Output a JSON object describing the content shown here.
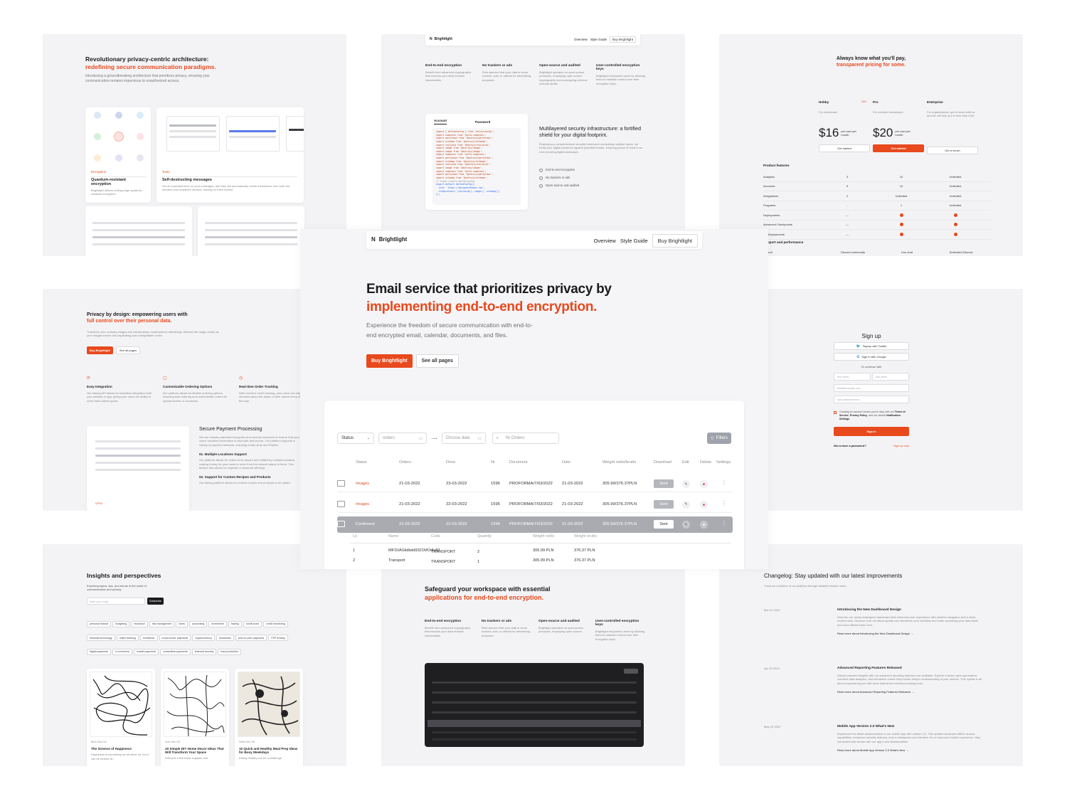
{
  "brand": {
    "name": "Brightlight"
  },
  "nav": {
    "overview": "Overview",
    "style_guide": "Style Guide",
    "buy": "Buy Brightlight"
  },
  "panel_arch": {
    "title1": "Revolutionary privacy-centric architecture:",
    "title2": "redefining secure communication paradigms.",
    "desc": "Introducing a groundbreaking architecture that prioritizes privacy, ensuring your communication remains impervious to unauthorized access.",
    "card1": {
      "tag": "Encryption",
      "title": "Quantum-resistant encryption",
      "desc": "Brightlight utilizes cutting-edge quantum-resistant encryption."
    },
    "card2": {
      "tag": "Tools",
      "title": "Self-destructing messages",
      "desc": "Set an expiration time on your messages, and they will automatically delete themselves from both the senders and recipient's devices, leaving no trace behind."
    }
  },
  "panel_features_top": {
    "features": [
      {
        "title": "End-to-end encryption",
        "desc": "Benefit from advanced cryptography that ensures your data remains inaccessible."
      },
      {
        "title": "No trackers or ads",
        "desc": "Rest assured that your data is never tracked, sold, or utilized for advertising purposes."
      },
      {
        "title": "Open-source and audited",
        "desc": "Brightlight operates on open-source principles, employing open source cryptography and undergoing external security audits."
      },
      {
        "title": "User-controlled encryption keys",
        "desc": "Brightlight empowers users by allowing them to maintain control over their encryption keys."
      }
    ],
    "tabs": [
      "Account",
      "Password"
    ],
    "code": [
      "import { defineConfig } from 'astro/config';",
      "import compress from 'astro-compress';",
      "import partytown from '@astrojs/partytown';",
      "import sitemap from '@astrojs/sitemap';",
      "import tailwind from '@astrojs/tailwind';",
      "import image from '@astrojs/image';",
      "import image from '@astrojs/image';",
      "import compress from 'astro-compress';",
      "import partytown from '@astrojs/partytown';",
      "import sitemap from '@astrojs/sitemap';",
      "import tailwind from '@astrojs/tailwind';",
      "import image from '@astrojs/image';",
      "import compress from 'astro-compress';",
      "import partytown from '@astrojs/partytown';",
      "import sitemap from '@astrojs/sitemap';",
      "// https://astro.build/config",
      "export default defineConfig({",
      "  site: 'https://designerthemes.com',",
      "  integrations: [tailwind(), image(), sitemap()]",
      "});"
    ],
    "security_title": "Multilayered security infrastructure: a fortified shield for your digital footprint.",
    "security_desc": "Employing a comprehensive security framework comprising multiple layers, we fortify your digital presence against potential threats, ensuring peace of mind in an ever-evolving digital landscape.",
    "checks": [
      "End-to-end encryption",
      "No trackers or ads",
      "Open-source and audited"
    ]
  },
  "panel_pricing": {
    "title1": "Always know what you'll pay,",
    "title2": "transparent pricing for some.",
    "plans": [
      {
        "name": "Hobby",
        "badge": "",
        "desc": "For individuals",
        "price": "$16",
        "unit": "per user per month",
        "cta": "Get started"
      },
      {
        "name": "Pro",
        "badge": "40%",
        "desc": "For medium businesses",
        "price": "$20",
        "unit": "per user per month",
        "cta": "Get started"
      },
      {
        "name": "Enterprise",
        "badge": "",
        "desc": "For organizations, get in touch with us and we will help you in less than 24hr.",
        "price": "",
        "unit": "",
        "cta": "Get in touch"
      }
    ],
    "section": "Product features",
    "rows": [
      {
        "label": "Analytics",
        "v": [
          "3",
          "10",
          "Unlimited"
        ]
      },
      {
        "label": "Accounts",
        "v": [
          "5",
          "10",
          "Unlimited"
        ]
      },
      {
        "label": "Integrations",
        "v": [
          "2",
          "Unlimited",
          "Unlimited"
        ]
      },
      {
        "label": "Programs",
        "v": [
          "-",
          "1",
          "Unlimited"
        ]
      },
      {
        "label": "Deployments",
        "v": [
          "—",
          "dot",
          "dot"
        ]
      },
      {
        "label": "Advanced Checkpoints",
        "v": [
          "—",
          "dot",
          "dot"
        ]
      },
      {
        "label": "ate Deployments",
        "v": [
          "—",
          "dot",
          "dot"
        ]
      }
    ],
    "section2": "pport and performance",
    "row_last": {
      "label": "port",
      "v": [
        "Discord community",
        "Live chat",
        "Dedicated Discord"
      ]
    }
  },
  "panel_privacy": {
    "title1": "Privacy by design: empowering users with",
    "title2": "full control over their personal data.",
    "desc": "Transform your ordinary images into extraordinary masterpieces effortlessly. Witness the magic unfold as your images evolve into captivating and unforgettable works",
    "buy": "Buy Brightlight",
    "see": "See all pages",
    "features": [
      {
        "title": "Easy Integration",
        "desc": "Our baking API allows for seamless integration with your website or app, giving your users the ability to order fresh baked goods."
      },
      {
        "title": "Customizable Ordering Options",
        "desc": "Our platform allows for flexible ordering options, including bulk ordering and customizable orders for special events or occasions."
      },
      {
        "title": "Real-time Order Tracking",
        "desc": "With real-time order tracking, your users can stay informed about the status of their orders every step of the way."
      }
    ],
    "payment_title": "Secure Payment Processing",
    "payment_desc": "We use industry-standard encryption and security measures to ensure that your users' sensitive information is kept safe and secure. Our platform supports a variety of payment methods, including credit cards and PayPal.",
    "sub1": "01. Multiple Locations Support",
    "sub1_desc": "Our platform allows for orders to be placed and fulfilled by multiple locations, making it easy for your users to order from the closest bakery to them. This feature also allows for regional or seasonal offerings.",
    "sub2": "02. Support for Custom Recipes and Products",
    "sub2_desc": "Our baking platform allows for custom recipes and products to be added",
    "tag": "GPNI"
  },
  "hero": {
    "title1": "Email service that prioritizes privacy by",
    "title2": "implementing end-to-end encryption.",
    "desc": "Experience the freedom of secure communication with end-to-end encrypted email, calendar, documents, and files.",
    "buy": "Buy Brightlight",
    "see": "See all pages"
  },
  "table": {
    "filter_status": "Status",
    "filter_orders": "orders",
    "filter_date": "Choose date",
    "search_placeholder": "Nr Orders",
    "filters_btn": "Filters",
    "headers": [
      "Status",
      "Orders",
      "Done",
      "Nr",
      "Document",
      "Date",
      "Weight netto/brutto",
      "Download",
      "Edit",
      "Delete",
      "Settings"
    ],
    "rows": [
      {
        "status": "Images",
        "orders": "21-03-2022",
        "done": "23-03-2022",
        "nr": "1596",
        "doc": "PROFORMA/7/03/2022",
        "date": "21-03-2022",
        "weight": "305.99/376.37PLN",
        "btn": "Sent"
      },
      {
        "status": "Images",
        "orders": "21-03-2022",
        "done": "22-03-2022",
        "nr": "1595",
        "doc": "PROFORMA/7/03/2022",
        "date": "21-03-2022",
        "weight": "305.99/376.37PLN",
        "btn": "Sent"
      },
      {
        "status": "Confirmed",
        "orders": "21-03-2022",
        "done": "22-03-2022",
        "nr": "1594",
        "doc": "PROFORMA/7/03/2022",
        "date": "21-03-2022",
        "weight": "305.99/376.37PLN",
        "btn": "Sent"
      }
    ],
    "sub_headers": [
      "Lp",
      "Name",
      "Code",
      "Quantity",
      "Weight netto",
      "Weight brutto"
    ],
    "sub_rows": [
      [
        "1",
        "MFSVASkdkdd9321MOdkdl2",
        "TRANSPORT",
        "2",
        "305.99 PLN",
        "376.37 PLN"
      ],
      [
        "2",
        "Transport",
        "TRANSPORT",
        "1",
        "305.99 PLN",
        "376.37 PLN"
      ]
    ]
  },
  "panel_signup": {
    "title": "Sign up",
    "twitter": "Signup with Twitter",
    "google": "Sign in with Google",
    "or": "Or continue with",
    "first": "Your name...",
    "last": "Last name...",
    "email": "email@example.com",
    "password": "Type password here...",
    "terms_pre": "Creating an account means you're okay with our",
    "terms_a": "Terms of Service",
    "terms_b": "Privacy Policy",
    "terms_mid": ", and our default",
    "terms_c": "Notification Settings",
    "signin": "Sign in",
    "no_pass": "Not a have a password?",
    "signup_now": "Sign up now"
  },
  "panel_blog": {
    "title": "Insights and perspectives",
    "desc": "Exploring topics, tips, and trends in the world of communication and privacy",
    "email_placeholder": "Enter your email",
    "subscribe": "Subscribe",
    "tags": [
      "personal finance",
      "budgeting",
      "insurance",
      "risk management",
      "taxes",
      "accounting",
      "investment",
      "trading",
      "credit score",
      "credit monitoring",
      "financial technology",
      "online banking",
      "remittance",
      "cross-border payments",
      "cryptocurrency",
      "blockchain",
      "peer-to-peer payments",
      "P2P lending",
      "digital payments",
      "e-commerce",
      "mobile payments",
      "contactless payments",
      "financial security",
      "fraud protection"
    ],
    "posts": [
      {
        "date": "Mon Dec 04",
        "title": "The Science of Happiness",
        "excerpt": "Happiness is something we all strive for, but it can be elusive at..."
      },
      {
        "date": "Sun Dec 03",
        "title": "10 Simple DIY Home Decor Ideas That Will Transform Your Space",
        "excerpt": "With just a few basic supplies and"
      },
      {
        "date": "Wed Dec 06",
        "title": "10 Quick and Healthy Meal Prep Ideas for Busy Weekdays",
        "excerpt": "Eating healthy can be a challenge"
      }
    ]
  },
  "panel_safeguard": {
    "title1": "Safeguard your workspace with essential",
    "title2": "applications for end-to-end encryption.",
    "features": [
      {
        "title": "End-to-end encryption",
        "desc": "Benefit from advanced cryptography that ensures your data remains inaccessible."
      },
      {
        "title": "No trackers or ads",
        "desc": "Rest assured that your data is never tracked, sold, or utilized for advertising purposes."
      },
      {
        "title": "Open-source and audited",
        "desc": "Brightlight operates on open-source principles, employing open-source."
      },
      {
        "title": "User-controlled encryption keys",
        "desc": "Brightlight empowers users by allowing them to maintain control over their encryption keys."
      }
    ]
  },
  "panel_changelog": {
    "title": "Changelog: Stay updated with our latest improvements",
    "desc": "Track the evolution of our platform through detailed release notes.",
    "entries": [
      {
        "date": "Mar 01 2024",
        "title": "Introducing the New Dashboard Design",
        "desc": "Dive into our newly redesigned dashboard that enhances user experience with intuitive navigation and a sleek, modern look. Discover how our latest update can streamline your workflow and make accessing your data faster and more efficient than ever.",
        "link": "Read more about Introducing the New Dashboard Design →"
      },
      {
        "date": "Apr 15 2024",
        "title": "Advanced Reporting Features Released",
        "desc": "Unlock powerful insights with our advanced reporting features now available. Explore custom report generation, real-time data analytics, and interactive charts that provide deeper understanding of your metrics. This update is all about empowering you with more data-driven decision-making tools.",
        "link": "Read more about Advanced Reporting Features Released →"
      },
      {
        "date": "May 20 2024",
        "title": "Mobile App Version 2.0 What's New",
        "desc": "Experience the latest advancements in our mobile app with version 2.0. This update introduces offline access capabilities, enhanced security features, and a redesigned user interface for an improved mobile experience. Stay connected and secure with our app's new functionalities.",
        "link": "Read more about Mobile App Version 2.0 What's New →"
      }
    ]
  },
  "colors": {
    "accent": "#e8491d",
    "panel": "#f3f3f5",
    "confirmed_row": "#a9abb1"
  }
}
